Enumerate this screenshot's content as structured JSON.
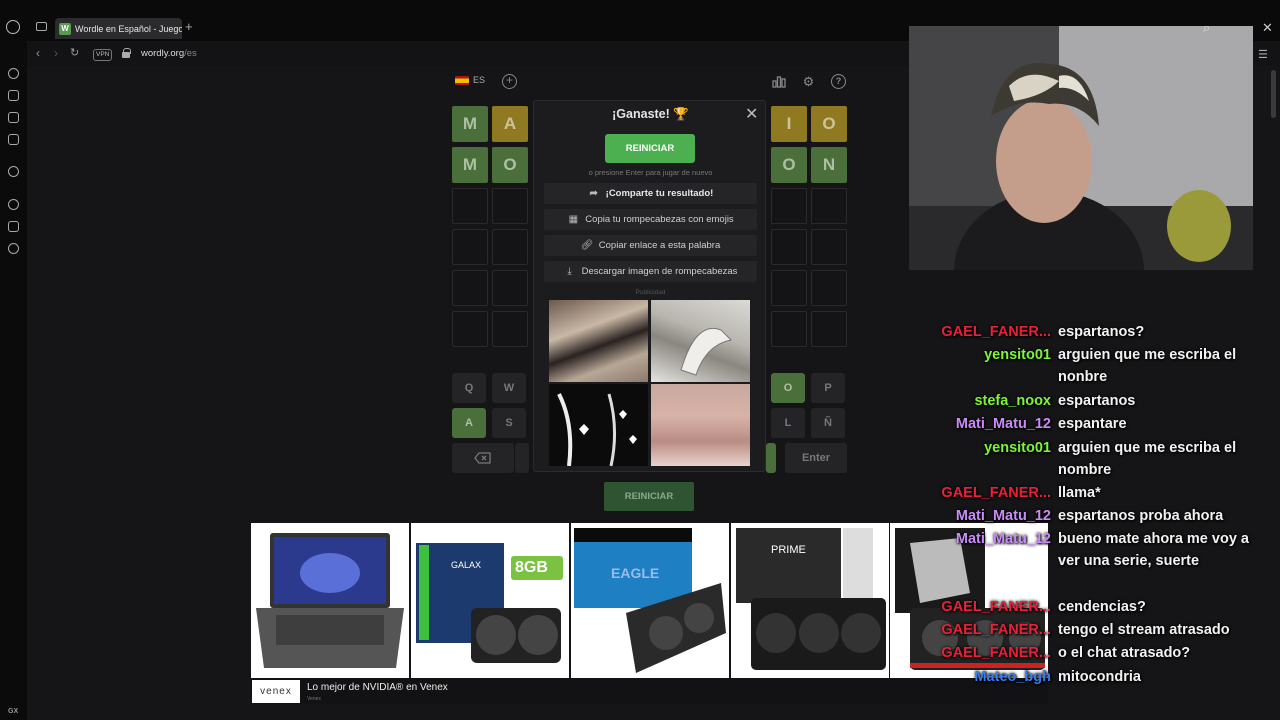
{
  "browser": {
    "tab_title": "Wordle en Español - Juego",
    "tab_favicon": "W",
    "vpn_label": "VPN",
    "url_host": "wordly.org",
    "url_path": "/es",
    "sidebar_gx": "GX"
  },
  "game": {
    "lang_label": "ES",
    "header_icons": [
      "add-icon",
      "stats-icon",
      "settings-icon",
      "help-icon"
    ],
    "rows": [
      [
        "M",
        "A",
        "",
        "",
        "I",
        "O"
      ],
      [
        "M",
        "O",
        "",
        "",
        "O",
        "N"
      ]
    ],
    "row_states": [
      [
        "correct",
        "present",
        "",
        "",
        "present",
        "present"
      ],
      [
        "correct",
        "correct",
        "",
        "",
        "correct",
        "correct"
      ]
    ],
    "keyboard": {
      "row1_left": [
        "Q",
        "W"
      ],
      "row1_right": [
        "O",
        "P"
      ],
      "row2_left": [
        "A",
        "S"
      ],
      "row2_right": [
        "L",
        "Ñ"
      ],
      "row3_enter": "Enter"
    },
    "bottom_button": "REINICIAR"
  },
  "modal": {
    "title": "¡Ganaste! 🏆",
    "restart_button": "REINICIAR",
    "hint": "o presione Enter para jugar de nuevo",
    "options": [
      {
        "label": "¡Comparte tu resultado!",
        "icon": "share-icon"
      },
      {
        "label": "Copia tu rompecabezas con emojis",
        "icon": "grid-icon"
      },
      {
        "label": "Copiar enlace a esta palabra",
        "icon": "link-icon"
      },
      {
        "label": "Descargar imagen de rompecabezas",
        "icon": "download-icon"
      }
    ],
    "ad_label": "Publicidad"
  },
  "ad_strip": {
    "badge_8gb": "8GB",
    "venex_logo": "venex",
    "title": "Lo mejor de NVIDIA® en Venex",
    "subtitle": "Venex"
  },
  "chat": [
    {
      "user": "GAEL_FANER...",
      "color": "#e8213b",
      "msg": "espartanos?"
    },
    {
      "user": "yensito01",
      "color": "#7cf53a",
      "msg": "arguien que me escriba el nonbre"
    },
    {
      "user": "stefa_noox",
      "color": "#7cf53a",
      "msg": "espartanos"
    },
    {
      "user": "Mati_Matu_12",
      "color": "#c98cf7",
      "msg": "espantare"
    },
    {
      "user": "yensito01",
      "color": "#7cf53a",
      "msg": "arguien que me escriba el nombre"
    },
    {
      "user": "GAEL_FANER...",
      "color": "#e8213b",
      "msg": "llama*"
    },
    {
      "user": "Mati_Matu_12",
      "color": "#c98cf7",
      "msg": "espartanos proba ahora"
    },
    {
      "user": "Mati_Matu_12",
      "color": "#c98cf7",
      "msg": "bueno mate ahora me voy a ver una serie, suerte"
    },
    {
      "user": "GAEL_FANER...",
      "color": "#e8213b",
      "msg": "cendencias?"
    },
    {
      "user": "GAEL_FANER...",
      "color": "#e8213b",
      "msg": "tengo el stream atrasado"
    },
    {
      "user": "GAEL_FANER...",
      "color": "#e8213b",
      "msg": "o el chat atrasado?"
    },
    {
      "user": "Mateo_bgh",
      "color": "#3b7ce8",
      "msg": "mitocondria"
    }
  ]
}
